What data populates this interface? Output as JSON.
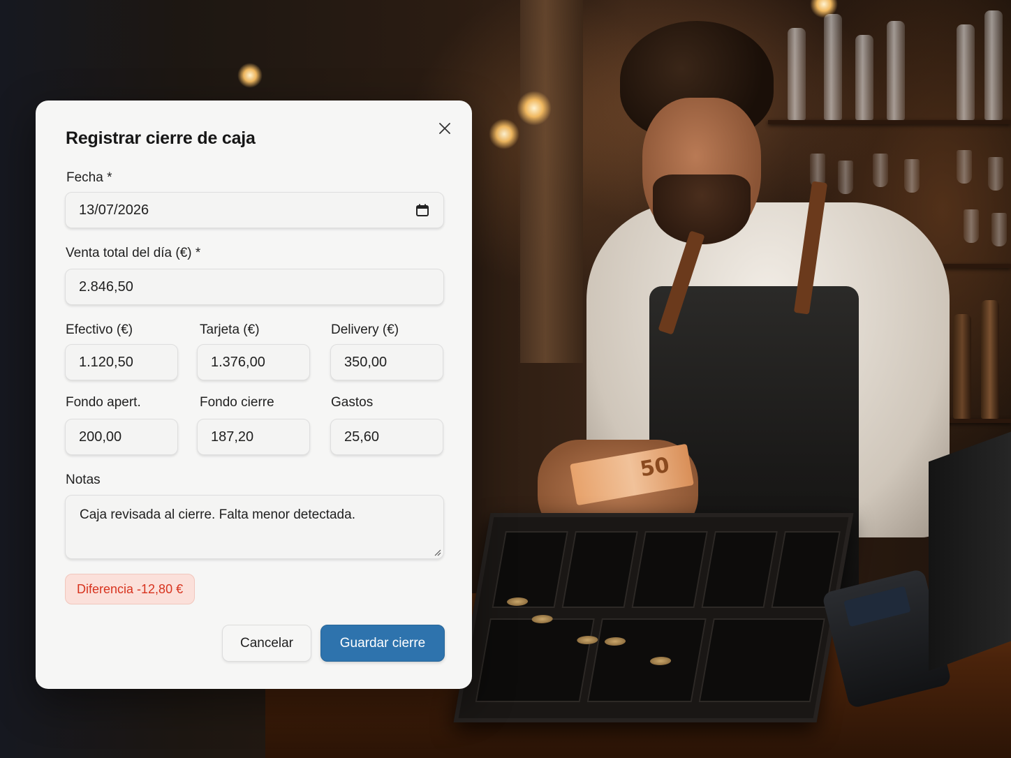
{
  "dialog": {
    "title": "Registrar cierre de caja",
    "close_icon": "close-icon"
  },
  "form": {
    "fecha": {
      "label": "Fecha *",
      "value": "13/07/2026",
      "icon": "calendar-icon"
    },
    "venta_total": {
      "label": "Venta total del día (€) *",
      "value": "2.846,50"
    },
    "efectivo": {
      "label": "Efectivo (€)",
      "value": "1.120,50"
    },
    "tarjeta": {
      "label": "Tarjeta (€)",
      "value": "1.376,00"
    },
    "delivery": {
      "label": "Delivery (€)",
      "value": "350,00"
    },
    "fondo_apert": {
      "label": "Fondo apert.",
      "value": "200,00"
    },
    "fondo_cierre": {
      "label": "Fondo cierre",
      "value": "187,20"
    },
    "gastos": {
      "label": "Gastos",
      "value": "25,60"
    },
    "notas": {
      "label": "Notas",
      "value": "Caja revisada al cierre. Falta menor detectada."
    }
  },
  "difference": {
    "text": "Diferencia -12,80 €",
    "color": "#d7331e"
  },
  "actions": {
    "cancel_label": "Cancelar",
    "save_label": "Guardar cierre",
    "save_color": "#2e73ad"
  },
  "background": {
    "banknote_text": "50"
  }
}
